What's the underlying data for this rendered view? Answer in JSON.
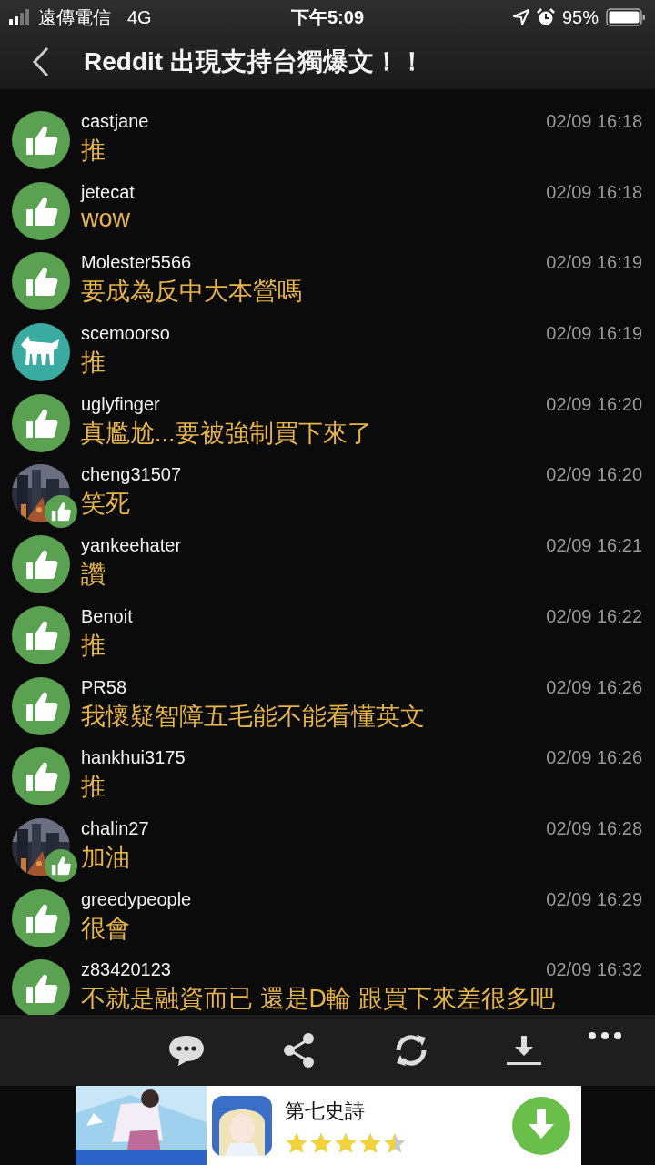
{
  "status_bar": {
    "carrier": "遠傳電信",
    "network": "4G",
    "time": "下午5:09",
    "battery": "95%"
  },
  "nav": {
    "title": "Reddit 出現支持台獨爆文！！"
  },
  "comments": [
    {
      "kind": "like",
      "user": "castjane",
      "text": "推",
      "time": "02/09 16:18"
    },
    {
      "kind": "like",
      "user": "jetecat",
      "text": "wow",
      "time": "02/09 16:18"
    },
    {
      "kind": "like",
      "user": "Molester5566",
      "text": "要成為反中大本營嗎",
      "time": "02/09 16:19"
    },
    {
      "kind": "wolf",
      "user": "scemoorso",
      "text": "推",
      "time": "02/09 16:19"
    },
    {
      "kind": "like",
      "user": "uglyfinger",
      "text": "真尷尬...要被強制買下來了",
      "time": "02/09 16:20"
    },
    {
      "kind": "picture",
      "user": "cheng31507",
      "text": "笑死",
      "time": "02/09 16:20"
    },
    {
      "kind": "like",
      "user": "yankeehater",
      "text": "讚",
      "time": "02/09 16:21"
    },
    {
      "kind": "like",
      "user": "Benoit",
      "text": "推",
      "time": "02/09 16:22"
    },
    {
      "kind": "like",
      "user": "PR58",
      "text": "我懷疑智障五毛能不能看懂英文",
      "time": "02/09 16:26"
    },
    {
      "kind": "like",
      "user": "hankhui3175",
      "text": "推",
      "time": "02/09 16:26"
    },
    {
      "kind": "picture",
      "user": "chalin27",
      "text": "加油",
      "time": "02/09 16:28"
    },
    {
      "kind": "like",
      "user": "greedypeople",
      "text": "很會",
      "time": "02/09 16:29"
    },
    {
      "kind": "like",
      "user": "z83420123",
      "text": "不就是融資而已 還是D輪 跟買下來差很多吧",
      "time": "02/09 16:32"
    }
  ],
  "ad": {
    "title": "第七史詩",
    "stars": 4.5
  }
}
